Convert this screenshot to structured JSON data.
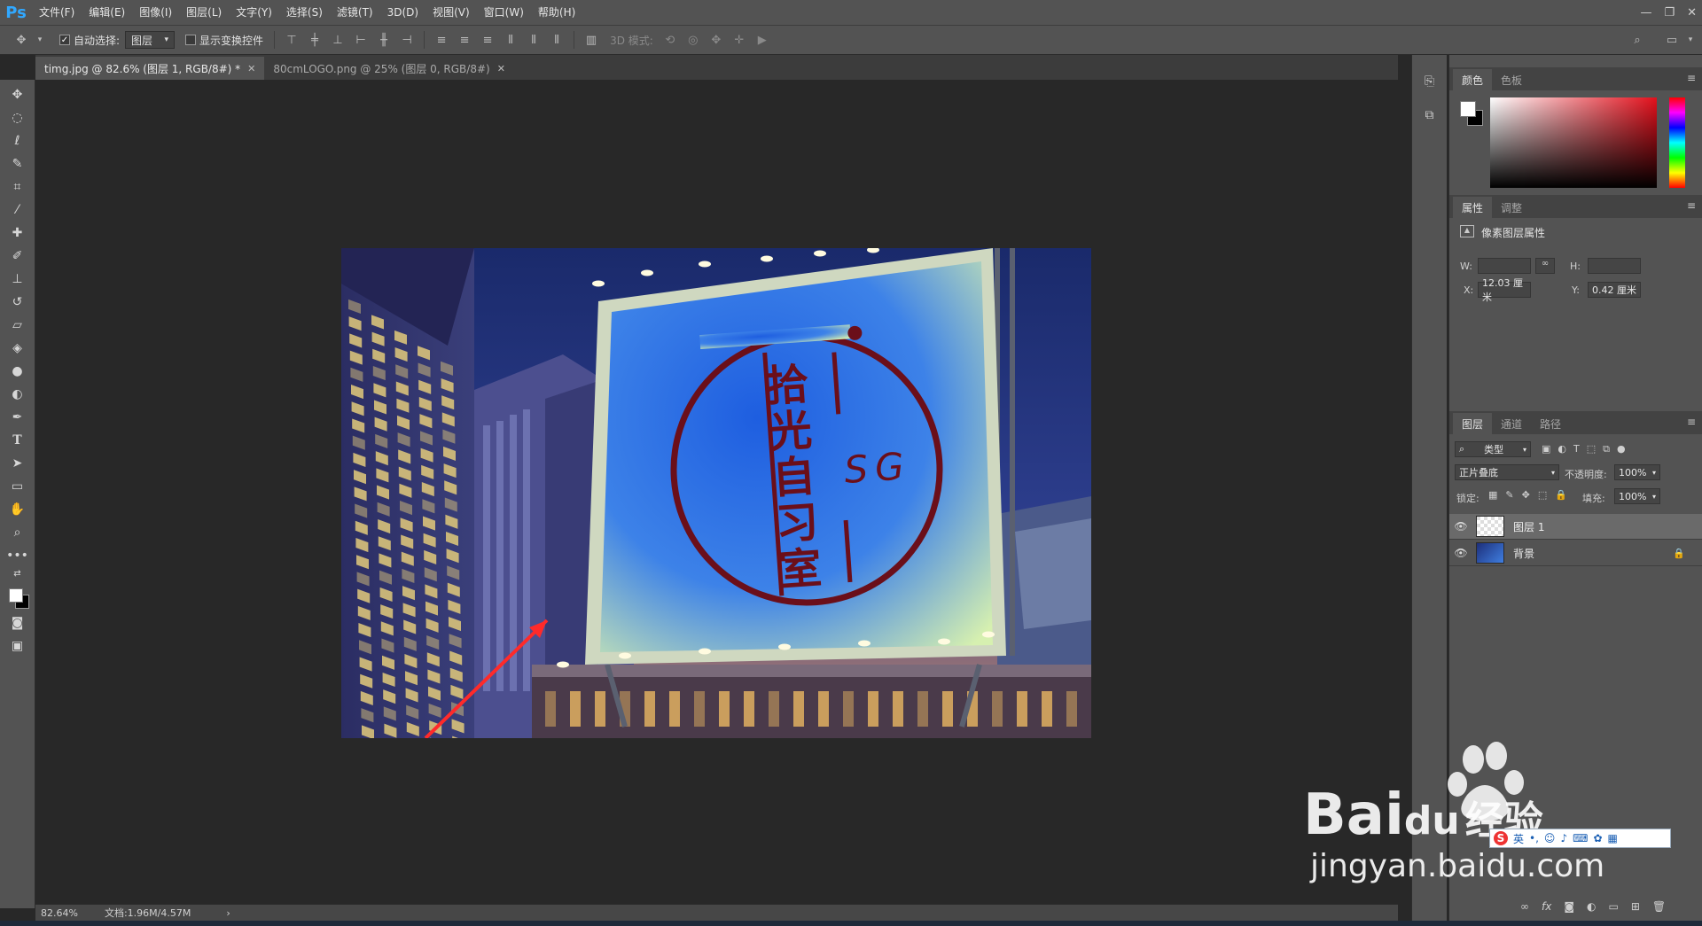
{
  "app": {
    "logo": "Ps",
    "menu": [
      "文件(F)",
      "编辑(E)",
      "图像(I)",
      "图层(L)",
      "文字(Y)",
      "选择(S)",
      "滤镜(T)",
      "3D(D)",
      "视图(V)",
      "窗口(W)",
      "帮助(H)"
    ]
  },
  "options": {
    "auto_select_label": "自动选择:",
    "auto_select_value": "图层",
    "show_transform_label": "显示变换控件",
    "mode_3d_label": "3D 模式:"
  },
  "tabs": [
    {
      "label": "timg.jpg @ 82.6% (图层 1, RGB/8#) *",
      "active": true
    },
    {
      "label": "80cmLOGO.png @ 25% (图层 0, RGB/8#)",
      "active": false
    }
  ],
  "canvas": {
    "logo_chars": [
      "拾",
      "光",
      "自",
      "习",
      "室"
    ],
    "logo_en": "SG"
  },
  "status": {
    "zoom": "82.64%",
    "doc": "文档:1.96M/4.57M"
  },
  "panels": {
    "color": {
      "tabs": [
        "颜色",
        "色板"
      ]
    },
    "properties": {
      "tabs": [
        "属性",
        "调整"
      ],
      "title": "像素图层属性",
      "w_label": "W:",
      "h_label": "H:",
      "x_label": "X:",
      "x_value": "12.03 厘米",
      "y_label": "Y:",
      "y_value": "0.42 厘米"
    },
    "layers": {
      "tabs": [
        "图层",
        "通道",
        "路径"
      ],
      "filter_label": "类型",
      "blend_mode": "正片叠底",
      "opacity_label": "不透明度:",
      "opacity_value": "100%",
      "lock_label": "锁定:",
      "fill_label": "填充:",
      "fill_value": "100%",
      "items": [
        {
          "name": "图层 1",
          "selected": true
        },
        {
          "name": "背景",
          "selected": false
        }
      ]
    }
  },
  "watermark": {
    "brand": "Bai",
    "brand2": "du",
    "brand_cn": "经验",
    "url": "jingyan.baidu.com",
    "ime": "英"
  },
  "colors": {
    "ps_blue": "#31a8ff",
    "panel_bg": "#535353",
    "canvas_bg": "#282828"
  }
}
